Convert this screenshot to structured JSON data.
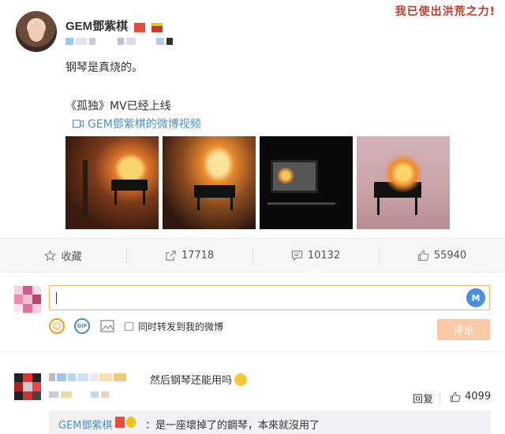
{
  "watermark": "我已使出洪荒之力!",
  "post": {
    "author": "GEM鄧紫棋",
    "text": "钢琴是真烧的。",
    "mv_line": "《孤独》MV已经上线",
    "video_link": "GEM鄧紫棋的微博视频"
  },
  "actions": {
    "favorite": "收藏",
    "repost_count": "17718",
    "comment_count": "10132",
    "like_count": "55940"
  },
  "composer": {
    "input_value": "",
    "forward_label": "同时转发到我的微博",
    "submit_label": "评论"
  },
  "comment": {
    "text": "然后钢琴还能用吗",
    "reply_label": "回复",
    "like_count": "4099"
  },
  "sub_reply": {
    "name": "GEM鄧紫棋",
    "text": "：是一座壞掉了的鋼琴，本來就沒用了"
  },
  "colors": {
    "link": "#4f8ec4",
    "accent_orange": "#f7b26a",
    "submit_disabled": "#fbc9a6"
  }
}
